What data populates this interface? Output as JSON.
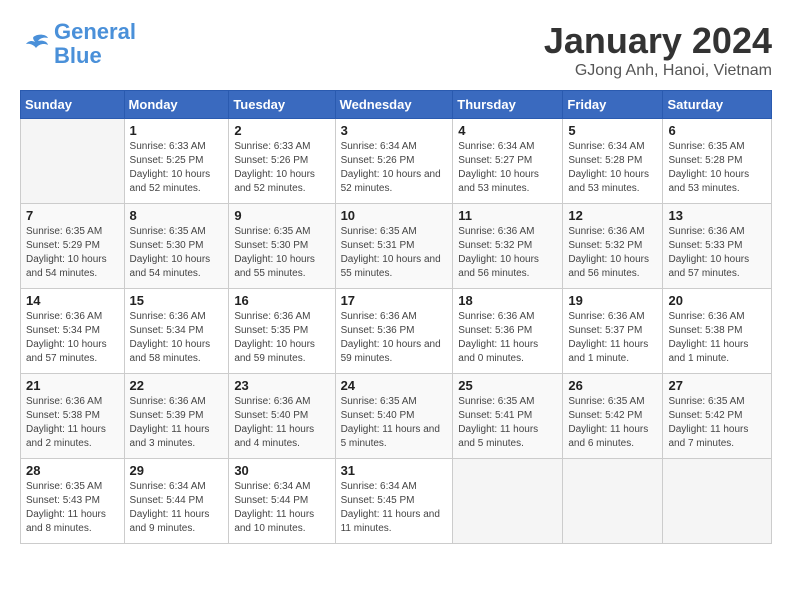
{
  "header": {
    "logo_general": "General",
    "logo_blue": "Blue",
    "title": "January 2024",
    "subtitle": "GJong Anh, Hanoi, Vietnam"
  },
  "weekdays": [
    "Sunday",
    "Monday",
    "Tuesday",
    "Wednesday",
    "Thursday",
    "Friday",
    "Saturday"
  ],
  "weeks": [
    [
      {
        "day": "",
        "sunrise": "",
        "sunset": "",
        "daylight": ""
      },
      {
        "day": "1",
        "sunrise": "6:33 AM",
        "sunset": "5:25 PM",
        "daylight": "10 hours and 52 minutes."
      },
      {
        "day": "2",
        "sunrise": "6:33 AM",
        "sunset": "5:26 PM",
        "daylight": "10 hours and 52 minutes."
      },
      {
        "day": "3",
        "sunrise": "6:34 AM",
        "sunset": "5:26 PM",
        "daylight": "10 hours and 52 minutes."
      },
      {
        "day": "4",
        "sunrise": "6:34 AM",
        "sunset": "5:27 PM",
        "daylight": "10 hours and 53 minutes."
      },
      {
        "day": "5",
        "sunrise": "6:34 AM",
        "sunset": "5:28 PM",
        "daylight": "10 hours and 53 minutes."
      },
      {
        "day": "6",
        "sunrise": "6:35 AM",
        "sunset": "5:28 PM",
        "daylight": "10 hours and 53 minutes."
      }
    ],
    [
      {
        "day": "7",
        "sunrise": "6:35 AM",
        "sunset": "5:29 PM",
        "daylight": "10 hours and 54 minutes."
      },
      {
        "day": "8",
        "sunrise": "6:35 AM",
        "sunset": "5:30 PM",
        "daylight": "10 hours and 54 minutes."
      },
      {
        "day": "9",
        "sunrise": "6:35 AM",
        "sunset": "5:30 PM",
        "daylight": "10 hours and 55 minutes."
      },
      {
        "day": "10",
        "sunrise": "6:35 AM",
        "sunset": "5:31 PM",
        "daylight": "10 hours and 55 minutes."
      },
      {
        "day": "11",
        "sunrise": "6:36 AM",
        "sunset": "5:32 PM",
        "daylight": "10 hours and 56 minutes."
      },
      {
        "day": "12",
        "sunrise": "6:36 AM",
        "sunset": "5:32 PM",
        "daylight": "10 hours and 56 minutes."
      },
      {
        "day": "13",
        "sunrise": "6:36 AM",
        "sunset": "5:33 PM",
        "daylight": "10 hours and 57 minutes."
      }
    ],
    [
      {
        "day": "14",
        "sunrise": "6:36 AM",
        "sunset": "5:34 PM",
        "daylight": "10 hours and 57 minutes."
      },
      {
        "day": "15",
        "sunrise": "6:36 AM",
        "sunset": "5:34 PM",
        "daylight": "10 hours and 58 minutes."
      },
      {
        "day": "16",
        "sunrise": "6:36 AM",
        "sunset": "5:35 PM",
        "daylight": "10 hours and 59 minutes."
      },
      {
        "day": "17",
        "sunrise": "6:36 AM",
        "sunset": "5:36 PM",
        "daylight": "10 hours and 59 minutes."
      },
      {
        "day": "18",
        "sunrise": "6:36 AM",
        "sunset": "5:36 PM",
        "daylight": "11 hours and 0 minutes."
      },
      {
        "day": "19",
        "sunrise": "6:36 AM",
        "sunset": "5:37 PM",
        "daylight": "11 hours and 1 minute."
      },
      {
        "day": "20",
        "sunrise": "6:36 AM",
        "sunset": "5:38 PM",
        "daylight": "11 hours and 1 minute."
      }
    ],
    [
      {
        "day": "21",
        "sunrise": "6:36 AM",
        "sunset": "5:38 PM",
        "daylight": "11 hours and 2 minutes."
      },
      {
        "day": "22",
        "sunrise": "6:36 AM",
        "sunset": "5:39 PM",
        "daylight": "11 hours and 3 minutes."
      },
      {
        "day": "23",
        "sunrise": "6:36 AM",
        "sunset": "5:40 PM",
        "daylight": "11 hours and 4 minutes."
      },
      {
        "day": "24",
        "sunrise": "6:35 AM",
        "sunset": "5:40 PM",
        "daylight": "11 hours and 5 minutes."
      },
      {
        "day": "25",
        "sunrise": "6:35 AM",
        "sunset": "5:41 PM",
        "daylight": "11 hours and 5 minutes."
      },
      {
        "day": "26",
        "sunrise": "6:35 AM",
        "sunset": "5:42 PM",
        "daylight": "11 hours and 6 minutes."
      },
      {
        "day": "27",
        "sunrise": "6:35 AM",
        "sunset": "5:42 PM",
        "daylight": "11 hours and 7 minutes."
      }
    ],
    [
      {
        "day": "28",
        "sunrise": "6:35 AM",
        "sunset": "5:43 PM",
        "daylight": "11 hours and 8 minutes."
      },
      {
        "day": "29",
        "sunrise": "6:34 AM",
        "sunset": "5:44 PM",
        "daylight": "11 hours and 9 minutes."
      },
      {
        "day": "30",
        "sunrise": "6:34 AM",
        "sunset": "5:44 PM",
        "daylight": "11 hours and 10 minutes."
      },
      {
        "day": "31",
        "sunrise": "6:34 AM",
        "sunset": "5:45 PM",
        "daylight": "11 hours and 11 minutes."
      },
      {
        "day": "",
        "sunrise": "",
        "sunset": "",
        "daylight": ""
      },
      {
        "day": "",
        "sunrise": "",
        "sunset": "",
        "daylight": ""
      },
      {
        "day": "",
        "sunrise": "",
        "sunset": "",
        "daylight": ""
      }
    ]
  ]
}
